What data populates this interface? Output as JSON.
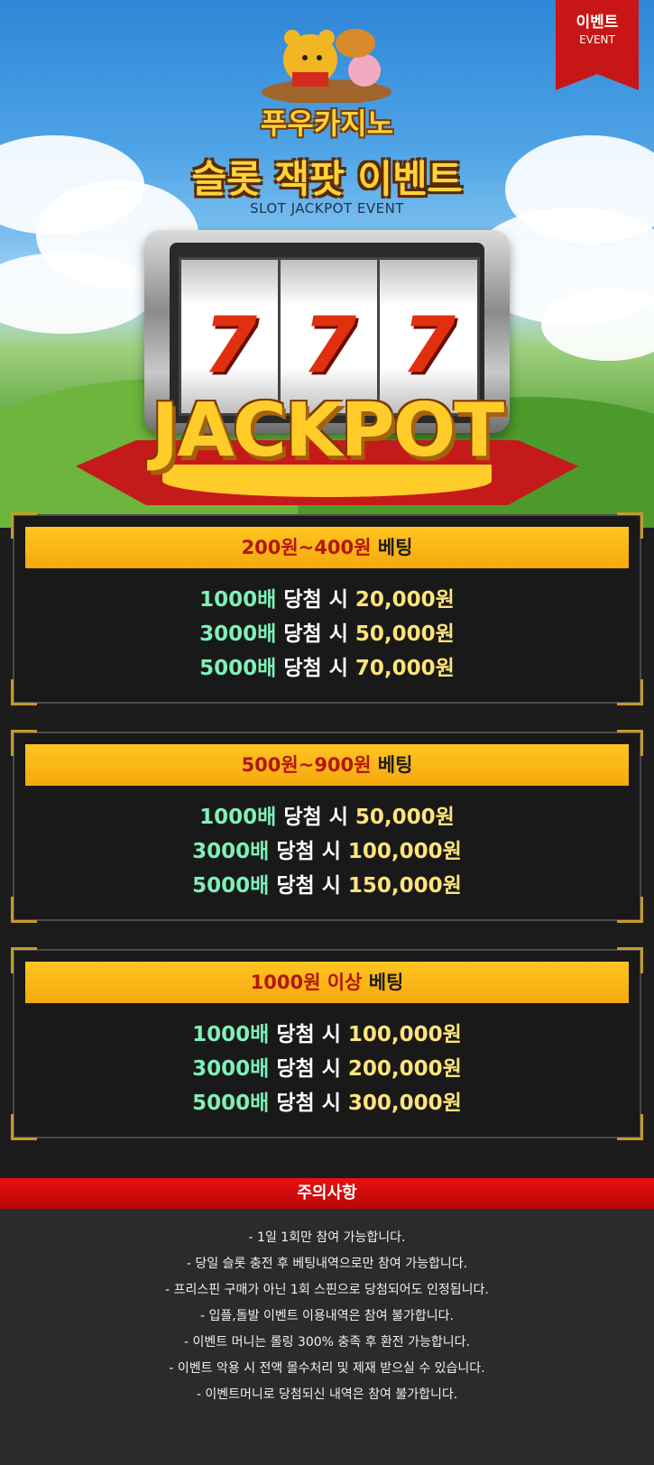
{
  "badge": {
    "title": "이벤트",
    "subtitle": "EVENT",
    "color": "#c81515"
  },
  "hero": {
    "brand": "푸우카지노",
    "event_title": "슬롯 잭팟 이벤트",
    "event_subtitle": "SLOT JACKPOT EVENT",
    "reels": [
      "7",
      "7",
      "7"
    ],
    "jackpot_text": "JACKPOT"
  },
  "tiers": [
    {
      "bet_range": "200원~400원",
      "bet_suffix": "베팅",
      "rows": [
        {
          "multiplier": "1000배",
          "label": "당첨 시",
          "amount": "20,000원"
        },
        {
          "multiplier": "3000배",
          "label": "당첨 시",
          "amount": "50,000원"
        },
        {
          "multiplier": "5000배",
          "label": "당첨 시",
          "amount": "70,000원"
        }
      ]
    },
    {
      "bet_range": "500원~900원",
      "bet_suffix": "베팅",
      "rows": [
        {
          "multiplier": "1000배",
          "label": "당첨 시",
          "amount": "50,000원"
        },
        {
          "multiplier": "3000배",
          "label": "당첨 시",
          "amount": "100,000원"
        },
        {
          "multiplier": "5000배",
          "label": "당첨 시",
          "amount": "150,000원"
        }
      ]
    },
    {
      "bet_range": "1000원 이상",
      "bet_suffix": "베팅",
      "rows": [
        {
          "multiplier": "1000배",
          "label": "당첨 시",
          "amount": "100,000원"
        },
        {
          "multiplier": "3000배",
          "label": "당첨 시",
          "amount": "200,000원"
        },
        {
          "multiplier": "5000배",
          "label": "당첨 시",
          "amount": "300,000원"
        }
      ]
    }
  ],
  "notice": {
    "title": "주의사항",
    "items": [
      "- 1일 1회만 참여 가능합니다.",
      "- 당일 슬롯 충전 후 베팅내역으로만 참여 가능합니다.",
      "- 프리스핀 구매가 아닌 1회 스핀으로 당첨되어도 인정됩니다.",
      "- 입플,돌발 이벤트 이용내역은 참여 불가합니다.",
      "- 이벤트 머니는 롤링 300% 충족 후 환전 가능합니다.",
      "- 이벤트 악용 시 전액 몰수처리 및 제재 받으실 수 있습니다.",
      "- 이벤트머니로 당첨되신 내역은 참여 불가합니다."
    ]
  },
  "colors": {
    "header_gold": "#ffc521",
    "bet_range_red": "#b3160c",
    "multiplier_green": "#7ff0b8",
    "amount_yellow": "#ffe47a",
    "notice_red": "#e81010"
  }
}
